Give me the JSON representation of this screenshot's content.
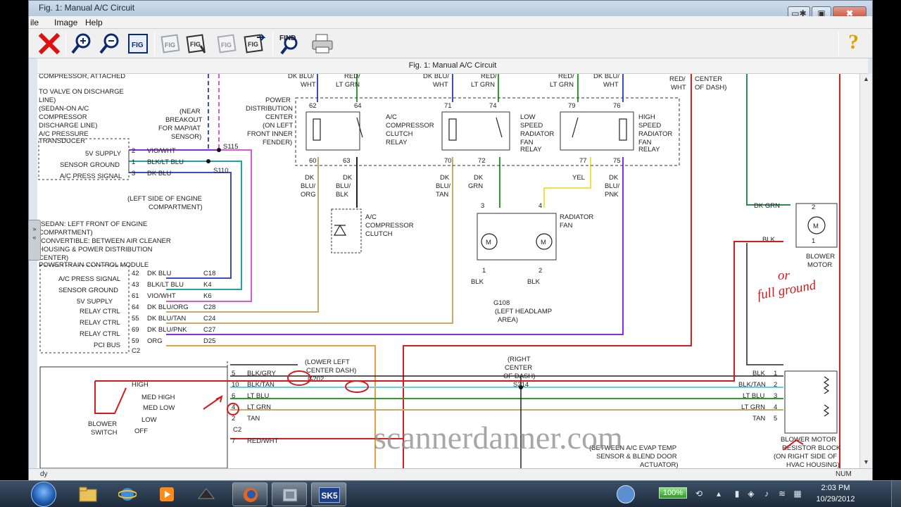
{
  "window": {
    "title": "Fig. 1: Manual A/C Circuit",
    "controls": {
      "minimize": "▭✱",
      "maximize": "▣",
      "close": "✖"
    }
  },
  "menu": {
    "file": "ile",
    "image": "Image",
    "help": "Help"
  },
  "toolbar": {
    "find_label": "FIND",
    "help_label": "?"
  },
  "figure_title": "Fig. 1: Manual A/C Circuit",
  "status": {
    "left": "dy",
    "num": "NUM"
  },
  "side_tab": "»\n«",
  "diagram": {
    "top_labels": {
      "dkblu_wht_1": "DK BLU/",
      "dkblu_wht_1b": "WHT",
      "red_ltgrn_1": "RED/",
      "red_ltgrn_1b": "LT GRN",
      "dkblu_wht_2": "DK BLU/",
      "dkblu_wht_2b": "WHT",
      "red_ltgrn_2": "RED/",
      "red_ltgrn_2b": "LT GRN",
      "red_ltgrn_3": "RED/",
      "red_ltgrn_3b": "LT GRN",
      "dkblu_wht_3": "DK BLU/",
      "dkblu_wht_3b": "WHT",
      "red_wht": "RED/",
      "red_wht_b": "WHT",
      "center": "CENTER",
      "of_dash": "OF DASH)"
    },
    "left_note": [
      "COMPRESSOR, ATTACHED",
      "TO VALVE ON DISCHARGE",
      "LINE)",
      "(SEDAN-ON A/C",
      "COMPRESSOR",
      "DISCHARGE LINE)",
      "A/C PRESSURE",
      "TRANSDUCER"
    ],
    "transducer_pins": [
      {
        "label": "5V SUPPLY",
        "pin": "2",
        "wire": "VIO/WHT"
      },
      {
        "label": "SENSOR GROUND",
        "pin": "1",
        "wire": "BLK/LT BLU"
      },
      {
        "label": "A/C PRESS SIGNAL",
        "pin": "3",
        "wire": "DK BLU"
      }
    ],
    "breakout": [
      "(NEAR",
      "BREAKOUT",
      "FOR MAP/IAT",
      "SENSOR)"
    ],
    "s115": "S115",
    "s110": "S110",
    "engine_note": [
      "(LEFT SIDE OF ENGINE",
      "COMPARTMENT)"
    ],
    "pdc": [
      "POWER",
      "DISTRIBUTION",
      "CENTER",
      "(ON LEFT",
      "FRONT INNER",
      "FENDER)"
    ],
    "relay1": {
      "name": [
        "A/C",
        "COMPRESSOR",
        "CLUTCH",
        "RELAY"
      ],
      "pins": [
        "62",
        "64",
        "60",
        "63"
      ]
    },
    "relay2": {
      "name": [
        "LOW",
        "SPEED",
        "RADIATOR",
        "FAN",
        "RELAY"
      ],
      "pins": [
        "71",
        "74",
        "70",
        "72"
      ]
    },
    "relay3": {
      "name": [
        "HIGH",
        "SPEED",
        "RADIATOR",
        "FAN",
        "RELAY"
      ],
      "pins": [
        "79",
        "76",
        "77",
        "75"
      ]
    },
    "wires_below_relays": [
      [
        "DK",
        "BLU/",
        "ORG"
      ],
      [
        "DK",
        "BLU/",
        "BLK"
      ],
      [
        "DK",
        "BLU/",
        "TAN"
      ],
      [
        "DK",
        "GRN"
      ],
      [
        "YEL"
      ],
      [
        "DK",
        "BLU/",
        "PNK"
      ]
    ],
    "clutch": [
      "A/C",
      "COMPRESSOR",
      "CLUTCH"
    ],
    "fan": {
      "name": [
        "RADIATOR",
        "FAN"
      ],
      "pin3": "3",
      "pin4": "4",
      "pin1": "1",
      "pin2": "2",
      "blk1": "BLK",
      "blk2": "BLK",
      "motor": "M"
    },
    "g108": [
      "G108",
      "(LEFT HEADLAMP",
      "AREA)"
    ],
    "pcm_note": [
      "(SEDAN: LEFT FRONT OF ENGINE",
      "COMPARTMENT)",
      "(CONVERTIBLE: BETWEEN AIR CLEANER",
      "HOUSING & POWER DISTRIBUTION",
      "CENTER)",
      "POWERTRAIN CONTROL MODULE"
    ],
    "pcm_rows": [
      {
        "label": "A/C PRESS SIGNAL",
        "pin": "42",
        "wire": "DK BLU",
        "cav": "C18"
      },
      {
        "label": "SENSOR GROUND",
        "pin": "43",
        "wire": "BLK/LT BLU",
        "cav": "K4"
      },
      {
        "label": "5V SUPPLY",
        "pin": "61",
        "wire": "VIO/WHT",
        "cav": "K6"
      },
      {
        "label": "RELAY CTRL",
        "pin": "64",
        "wire": "DK BLU/ORG",
        "cav": "C28"
      },
      {
        "label": "RELAY CTRL",
        "pin": "55",
        "wire": "DK BLU/TAN",
        "cav": "C24"
      },
      {
        "label": "RELAY CTRL",
        "pin": "69",
        "wire": "DK BLU/PNK",
        "cav": "C27"
      },
      {
        "label": "PCI BUS",
        "pin": "59",
        "wire": "ORG",
        "cav": "D25"
      }
    ],
    "pcm_c2": "C2",
    "blower_motor": {
      "pin2": "2",
      "pin1": "1",
      "wire2": "DK GRN",
      "wire1": "BLK",
      "name": [
        "BLOWER",
        "MOTOR"
      ],
      "motor": "M"
    },
    "lower_left": [
      "(LOWER LEFT",
      "CENTER DASH)"
    ],
    "g202": "G202",
    "right_center": [
      "(RIGHT",
      "CENTER",
      "OF DASH)"
    ],
    "s214": "S214",
    "switch_rows": [
      {
        "pin": "5",
        "wire": "BLK/GRY"
      },
      {
        "pin": "10",
        "wire": "BLK/TAN",
        "pos": "HIGH"
      },
      {
        "pin": "6",
        "wire": "LT BLU",
        "pos": "MED HIGH"
      },
      {
        "pin": "4",
        "wire": "LT GRN",
        "pos": "MED LOW"
      },
      {
        "pin": "2",
        "wire": "TAN",
        "pos": "LOW"
      }
    ],
    "switch_c2": "C2",
    "switch_name": [
      "BLOWER",
      "SWITCH"
    ],
    "switch_off": "OFF",
    "pin7": "7",
    "red_wht_bottom": "RED/WHT",
    "between": [
      "(BETWEEN A/C EVAP TEMP",
      "SENSOR & BLEND DOOR",
      "ACTUATOR)"
    ],
    "resistor_rows": [
      {
        "wire": "BLK",
        "pin": "1"
      },
      {
        "wire": "BLK/TAN",
        "pin": "2"
      },
      {
        "wire": "LT BLU",
        "pin": "3"
      },
      {
        "wire": "LT GRN",
        "pin": "4"
      },
      {
        "wire": "TAN",
        "pin": "5"
      }
    ],
    "resistor_name": [
      "BLOWER MOTOR",
      "RESISTOR BLOCK",
      "(ON RIGHT SIDE OF",
      "HVAC HOUSING)"
    ],
    "watermark": "scannerdanner.com",
    "handwriting": [
      "or",
      "full ground"
    ],
    "colors": {
      "blue": "#3a4ec0",
      "teal": "#1fa3a3",
      "pink": "#d65ad6",
      "vio": "#8a2be2",
      "tan": "#c8a96a",
      "green": "#2ca02c",
      "yellow": "#f2e24a",
      "red": "#d62020",
      "orange": "#e6a040",
      "cyan": "#5fd4e0",
      "dkgreen": "#2e8b57",
      "ink": "#d41a1a"
    }
  },
  "taskbar": {
    "sk5": "SK5",
    "battery": "100%",
    "time": "2:03 PM",
    "date": "10/29/2012"
  }
}
